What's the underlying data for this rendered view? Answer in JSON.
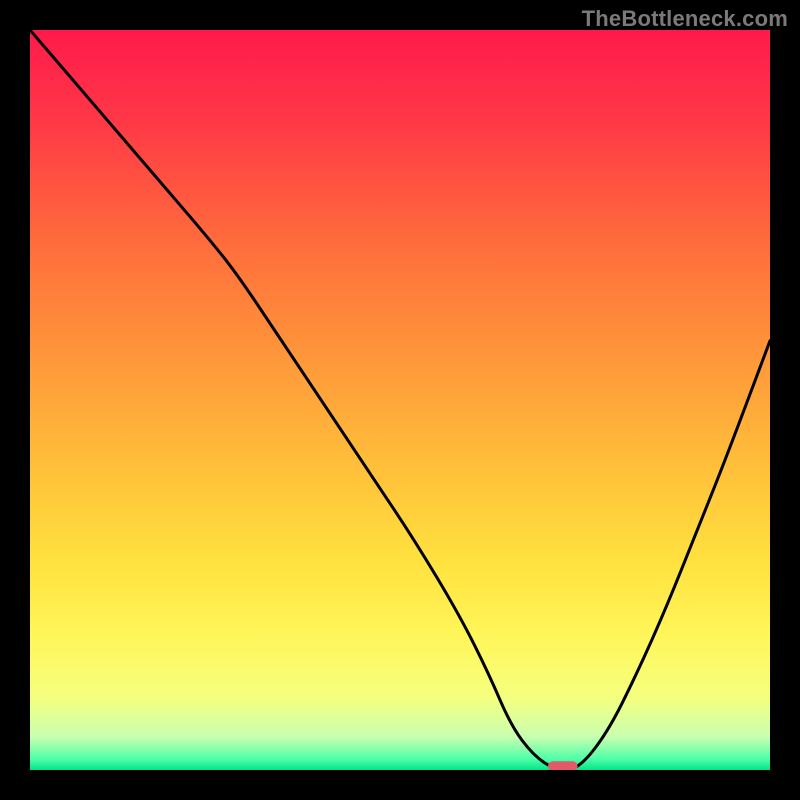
{
  "watermark": "TheBottleneck.com",
  "chart_data": {
    "type": "line",
    "title": "",
    "xlabel": "",
    "ylabel": "",
    "xlim": [
      0,
      100
    ],
    "ylim": [
      0,
      100
    ],
    "grid": false,
    "legend": false,
    "background": {
      "type": "vertical-gradient",
      "stops": [
        {
          "pos": 0.0,
          "color": "#ff1a4b"
        },
        {
          "pos": 0.12,
          "color": "#ff3747"
        },
        {
          "pos": 0.28,
          "color": "#ff6a3c"
        },
        {
          "pos": 0.45,
          "color": "#ff993a"
        },
        {
          "pos": 0.6,
          "color": "#ffc23a"
        },
        {
          "pos": 0.72,
          "color": "#ffe23f"
        },
        {
          "pos": 0.82,
          "color": "#fff65a"
        },
        {
          "pos": 0.9,
          "color": "#f6ff7d"
        },
        {
          "pos": 0.955,
          "color": "#c9ffb0"
        },
        {
          "pos": 0.985,
          "color": "#4fffa8"
        },
        {
          "pos": 1.0,
          "color": "#00e58a"
        }
      ]
    },
    "series": [
      {
        "name": "bottleneck-curve",
        "color": "#000000",
        "x": [
          0,
          6,
          12,
          18,
          24,
          28,
          34,
          40,
          46,
          52,
          58,
          62,
          65,
          68,
          71,
          74,
          78,
          82,
          86,
          90,
          94,
          100
        ],
        "y": [
          100,
          93,
          86,
          79,
          72,
          67,
          58,
          49,
          40,
          31,
          21,
          13,
          6,
          2,
          0,
          0,
          5,
          13,
          22,
          32,
          42,
          58
        ]
      }
    ],
    "marker": {
      "name": "optimal-point",
      "x_range": [
        70,
        74
      ],
      "y": 0.5,
      "color": "#e25a6a",
      "shape": "rounded-bar"
    }
  }
}
